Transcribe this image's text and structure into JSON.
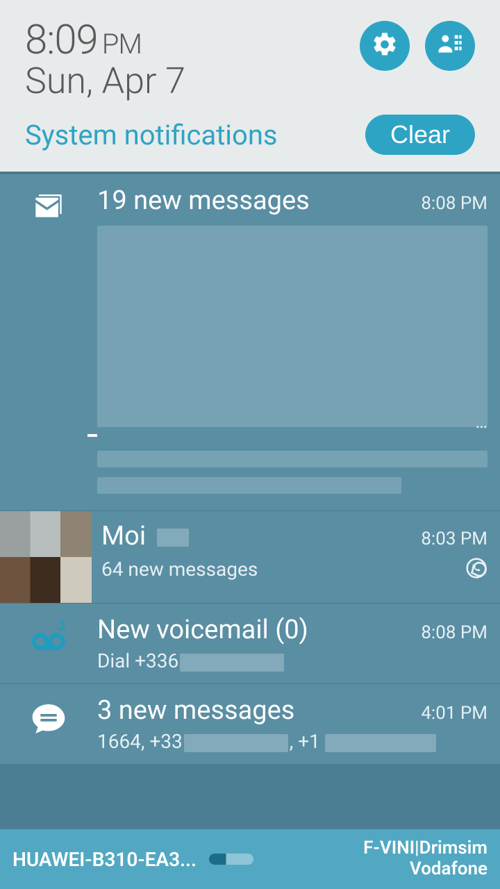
{
  "header": {
    "time": "8:09",
    "ampm": "PM",
    "date": "Sun, Apr 7",
    "section_label": "System notifications",
    "clear_label": "Clear"
  },
  "notifications": {
    "gmail": {
      "title": "19 new messages",
      "time": "8:08 PM"
    },
    "whatsapp": {
      "title": "Moi",
      "subtitle": "64 new messages",
      "time": "8:03 PM"
    },
    "voicemail": {
      "title": "New voicemail (0)",
      "subtitle_prefix": "Dial +336",
      "time": "8:08 PM"
    },
    "sms": {
      "title": "3 new messages",
      "subtitle_prefix": "1664, +33",
      "subtitle_mid": ", +1",
      "time": "4:01 PM"
    }
  },
  "statusbar": {
    "wifi_ssid": "HUAWEI-B310-EA3...",
    "carrier_line1": "F-VINI|Drimsim",
    "carrier_line2": "Vodafone"
  }
}
